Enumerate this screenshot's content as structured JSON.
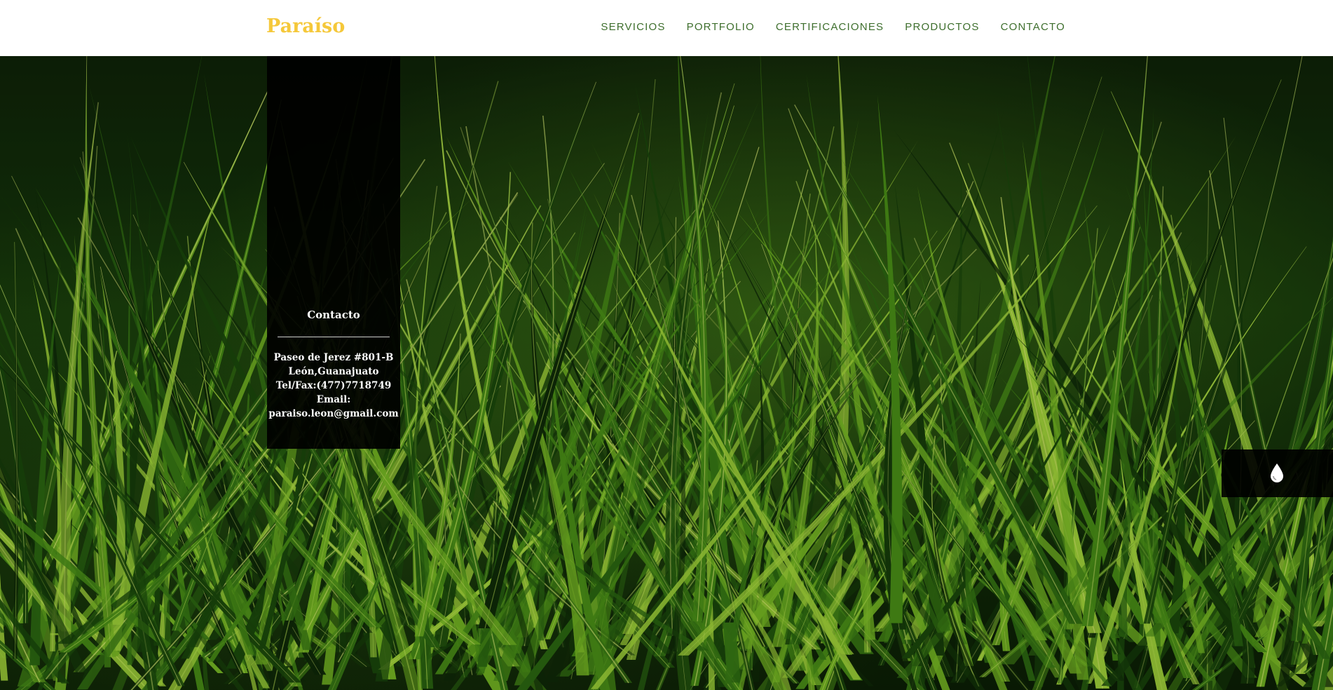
{
  "navbar": {
    "brand": "Paraíso",
    "links": [
      "SERVICIOS",
      "PORTFOLIO",
      "CERTIFICACIONES",
      "PRODUCTOS",
      "CONTACTO"
    ]
  },
  "contact": {
    "title": "Contacto",
    "lines": [
      "Paseo de Jerez #801-B",
      "León,Guanajuato",
      "Tel/Fax:(477)7718749",
      "Email:",
      "paraiso.leon@gmail.com"
    ]
  },
  "hero": {
    "background": "grass-photo"
  },
  "floating_button": {
    "icon": "water-drop-icon"
  },
  "colors": {
    "brand": "#f5c83a",
    "nav_text": "#3d6e2c",
    "panel_bg": "#000000",
    "grass_light": "#9ad23a",
    "grass_dark": "#0f2408"
  }
}
